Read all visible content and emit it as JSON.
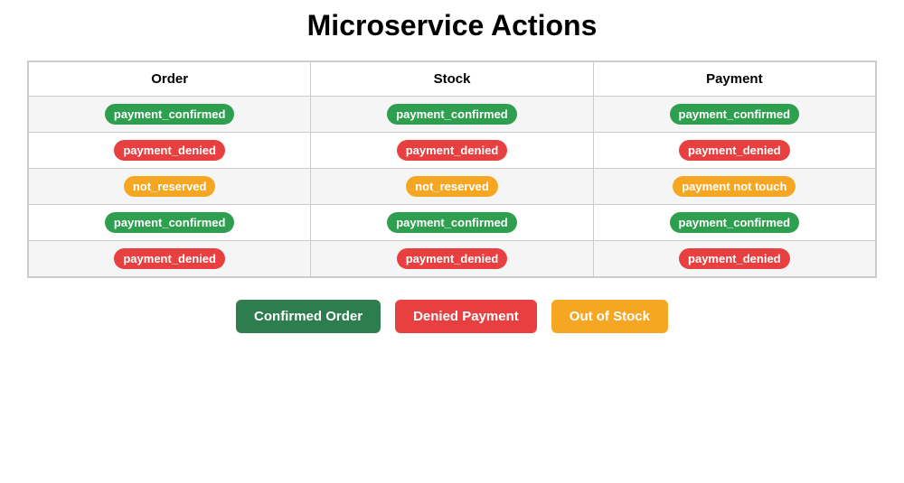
{
  "page": {
    "title": "Microservice Actions"
  },
  "table": {
    "headers": [
      "Order",
      "Stock",
      "Payment"
    ],
    "rows": [
      {
        "order": {
          "label": "payment_confirmed",
          "type": "green"
        },
        "stock": {
          "label": "payment_confirmed",
          "type": "green"
        },
        "payment": {
          "label": "payment_confirmed",
          "type": "green"
        }
      },
      {
        "order": {
          "label": "payment_denied",
          "type": "red"
        },
        "stock": {
          "label": "payment_denied",
          "type": "red"
        },
        "payment": {
          "label": "payment_denied",
          "type": "red"
        }
      },
      {
        "order": {
          "label": "not_reserved",
          "type": "yellow"
        },
        "stock": {
          "label": "not_reserved",
          "type": "yellow"
        },
        "payment": {
          "label": "payment not touch",
          "type": "yellow"
        }
      },
      {
        "order": {
          "label": "payment_confirmed",
          "type": "green"
        },
        "stock": {
          "label": "payment_confirmed",
          "type": "green"
        },
        "payment": {
          "label": "payment_confirmed",
          "type": "green"
        }
      },
      {
        "order": {
          "label": "payment_denied",
          "type": "red"
        },
        "stock": {
          "label": "payment_denied",
          "type": "red"
        },
        "payment": {
          "label": "payment_denied",
          "type": "red"
        }
      }
    ]
  },
  "legend": {
    "confirmed_order": "Confirmed Order",
    "denied_payment": "Denied Payment",
    "out_of_stock": "Out of Stock"
  }
}
